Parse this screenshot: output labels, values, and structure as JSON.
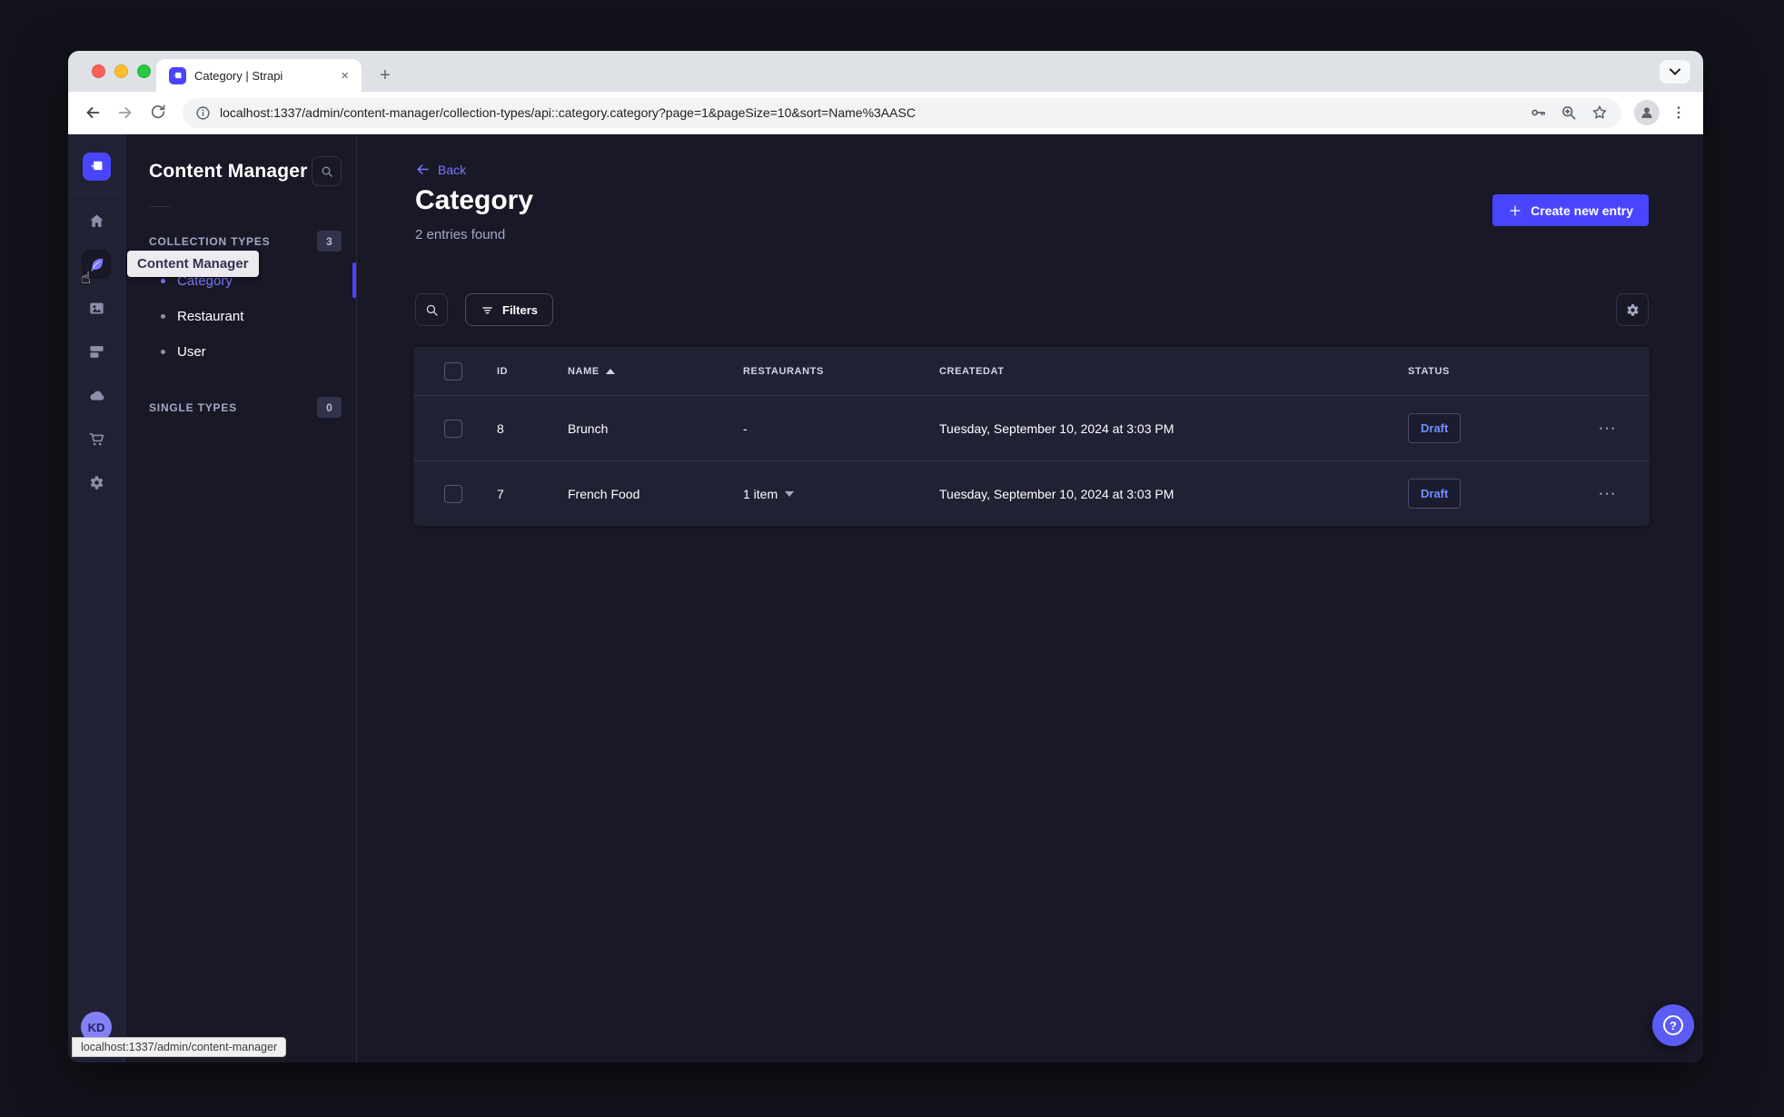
{
  "browser": {
    "tab_title": "Category | Strapi",
    "new_tab_label": "+",
    "close_tab_label": "×",
    "url": "localhost:1337/admin/content-manager/collection-types/api::category.category?page=1&pageSize=10&sort=Name%3AASC",
    "status_bubble": "localhost:1337/admin/content-manager"
  },
  "sidebar": {
    "tooltip": "Content Manager",
    "avatar_initials": "KD"
  },
  "subnav": {
    "title": "Content Manager",
    "sections": [
      {
        "label": "COLLECTION TYPES",
        "count": "3",
        "items": [
          {
            "label": "Category"
          },
          {
            "label": "Restaurant"
          },
          {
            "label": "User"
          }
        ]
      },
      {
        "label": "SINGLE TYPES",
        "count": "0",
        "items": []
      }
    ]
  },
  "main": {
    "back_label": "Back",
    "title": "Category",
    "entries_count": "2 entries found",
    "create_button_label": "Create new entry",
    "filters_button_label": "Filters",
    "row_actions_label": "⋯",
    "table": {
      "headers": {
        "id": "ID",
        "name": "NAME",
        "restaurants": "RESTAURANTS",
        "created_at": "CREATEDAT",
        "status": "STATUS"
      },
      "rows": [
        {
          "id": "8",
          "name": "Brunch",
          "restaurants": "-",
          "created_at": "Tuesday, September 10, 2024 at 3:03 PM",
          "status": "Draft"
        },
        {
          "id": "7",
          "name": "French Food",
          "restaurants": "1 item",
          "created_at": "Tuesday, September 10, 2024 at 3:03 PM",
          "status": "Draft"
        }
      ]
    }
  },
  "icons": {
    "rail": [
      "home",
      "content-manager",
      "media-library",
      "content-type-builder",
      "cloud",
      "marketplace",
      "settings"
    ],
    "help_button": "question-mark",
    "table_sort": "ascending-triangle"
  },
  "colors": {
    "primary": "#4945ff",
    "primary_light": "#7b79ff",
    "app_background": "#181826",
    "surface": "#212134",
    "border": "#32324d",
    "text_muted": "#a7a7c5",
    "status_draft": "#6f8fff"
  }
}
